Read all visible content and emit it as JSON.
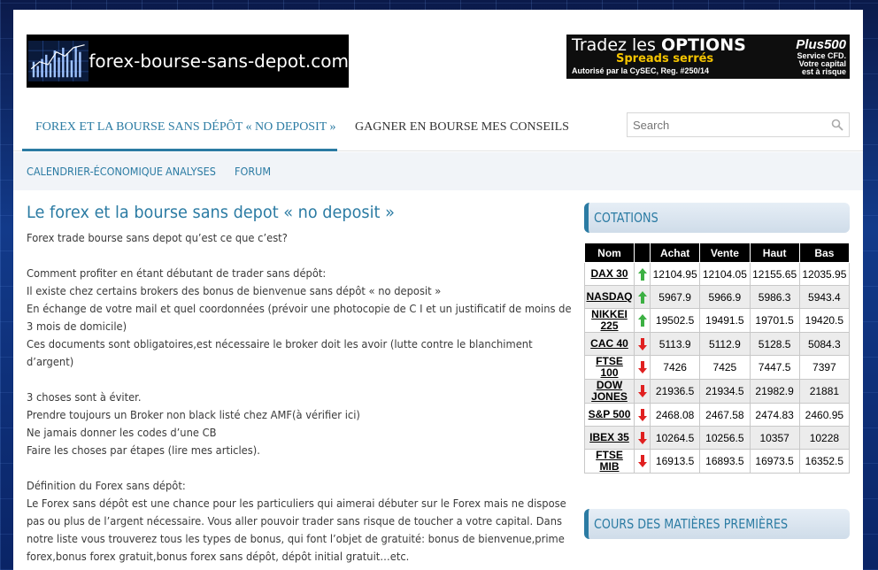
{
  "header": {
    "logo_text": "forex-bourse-sans-depot.com",
    "ad": {
      "line1_prefix": "Tradez les ",
      "line1_bold": "OPTIONS",
      "line2": "Spreads serrés",
      "line3": "Autorisé par la CySEC, Reg. #250/14",
      "brand": "Plus500",
      "brand_sub1": "Service CFD.",
      "brand_sub2": "Votre capital",
      "brand_sub3": "est à risque"
    }
  },
  "nav_primary": {
    "items": [
      {
        "label": "FOREX ET LA BOURSE SANS DÉPÔT « NO DEPOSIT »"
      },
      {
        "label": "GAGNER EN BOURSE MES CONSEILS"
      }
    ]
  },
  "search": {
    "placeholder": "Search"
  },
  "nav_secondary": {
    "items": [
      {
        "label": "CALENDRIER-ÉCONOMIQUE"
      },
      {
        "label": "ANALYSES"
      },
      {
        "label": "FORUM"
      }
    ]
  },
  "post": {
    "title": "Le forex et la bourse sans depot « no deposit »",
    "paragraphs": [
      "Forex trade bourse sans depot qu’est ce que c’est?",
      "Comment profiter en étant débutant de trader sans dépôt:",
      "Il existe chez certains brokers des bonus de bienvenue sans dépôt « no deposit »",
      "En échange de votre mail et quel coordonnées (prévoir une photocopie de C I et un justificatif de moins de 3 mois de domicile)",
      "Ces documents sont obligatoires,est nécessaire le broker doit les avoir (lutte contre le blanchiment d’argent)",
      "3 choses sont à éviter.",
      "Prendre toujours un Broker non black listé chez AMF(à vérifier ici)",
      "Ne jamais donner les codes d’une CB",
      "Faire les choses par étapes (lire mes articles).",
      "Définition du Forex sans dépôt:",
      "Le Forex sans dépôt est une chance pour les particuliers qui aimerai débuter sur le Forex mais ne dispose pas ou plus de l’argent nécessaire. Vous aller pouvoir trader sans risque de toucher a votre capital. Dans notre liste vous trouverez tous les types de bonus, qui font l’objet de gratuité: bonus de bienvenue,prime forex,bonus forex gratuit,bonus forex sans dépôt, dépôt initial gratuit…etc."
    ]
  },
  "sidebar": {
    "cotations_title": "COTATIONS",
    "table": {
      "headers": [
        "Nom",
        "",
        "Achat",
        "Vente",
        "Haut",
        "Bas"
      ],
      "rows": [
        {
          "name": "DAX 30",
          "dir": "up",
          "achat": "12104.95",
          "vente": "12104.05",
          "haut": "12155.65",
          "bas": "12035.95"
        },
        {
          "name": "NASDAQ",
          "dir": "up",
          "achat": "5967.9",
          "vente": "5966.9",
          "haut": "5986.3",
          "bas": "5943.4"
        },
        {
          "name": "NIKKEI 225",
          "dir": "up",
          "achat": "19502.5",
          "vente": "19491.5",
          "haut": "19701.5",
          "bas": "19420.5"
        },
        {
          "name": "CAC 40",
          "dir": "down",
          "achat": "5113.9",
          "vente": "5112.9",
          "haut": "5128.5",
          "bas": "5084.3"
        },
        {
          "name": "FTSE 100",
          "dir": "down",
          "achat": "7426",
          "vente": "7425",
          "haut": "7447.5",
          "bas": "7397"
        },
        {
          "name": "DOW JONES",
          "dir": "down",
          "achat": "21936.5",
          "vente": "21934.5",
          "haut": "21982.9",
          "bas": "21881"
        },
        {
          "name": "S&P 500",
          "dir": "down",
          "achat": "2468.08",
          "vente": "2467.58",
          "haut": "2474.83",
          "bas": "2460.95"
        },
        {
          "name": "IBEX 35",
          "dir": "down",
          "achat": "10264.5",
          "vente": "10256.5",
          "haut": "10357",
          "bas": "10228"
        },
        {
          "name": "FTSE MIB",
          "dir": "down",
          "achat": "16913.5",
          "vente": "16893.5",
          "haut": "16973.5",
          "bas": "16352.5"
        }
      ]
    },
    "commodities_title": "COURS DES MATIÈRES PREMIÈRES"
  },
  "colors": {
    "accent": "#2b7ba3",
    "up_arrow": "#3cb043",
    "down_arrow": "#e02020"
  }
}
